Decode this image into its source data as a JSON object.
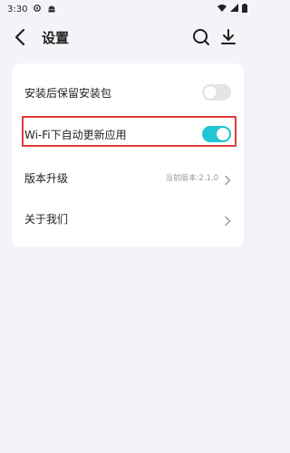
{
  "status_bar": {
    "time": "3:30",
    "icons": [
      "gear-icon",
      "android-icon",
      "wifi-icon",
      "signal-icon",
      "battery-icon"
    ]
  },
  "header": {
    "title": "设置",
    "icons": [
      "back-icon",
      "search-icon",
      "download-icon"
    ]
  },
  "settings": {
    "items": [
      {
        "label": "安装后保留安装包",
        "type": "toggle",
        "enabled": false
      },
      {
        "label": "Wi-Fi下自动更新应用",
        "type": "toggle",
        "enabled": true
      },
      {
        "label": "版本升级",
        "type": "link",
        "hint": "当前版本:2.1.0"
      },
      {
        "label": "关于我们",
        "type": "link"
      }
    ]
  },
  "colors": {
    "background": "#f2f4f7",
    "card": "#ffffff",
    "toggle_on": "#1fc6d4",
    "toggle_off": "#e3e4e7",
    "highlight": "#e23a3a"
  }
}
